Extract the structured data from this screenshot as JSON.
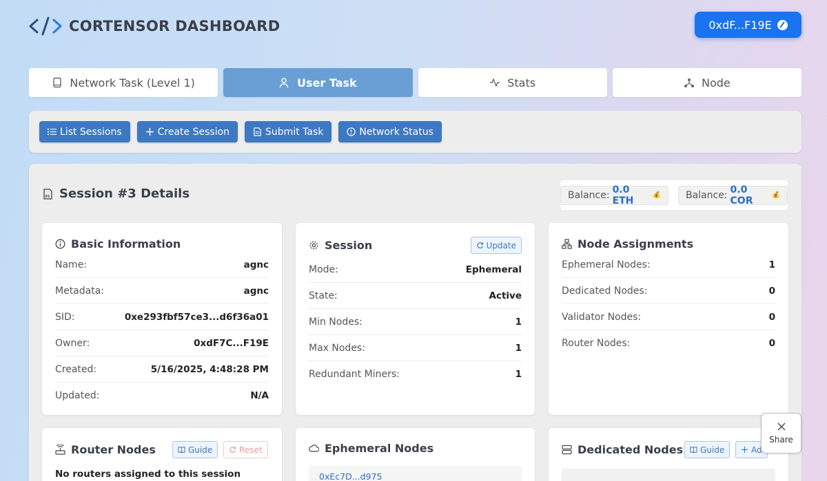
{
  "header": {
    "title": "CORTENSOR DASHBOARD",
    "wallet": "0xdF...F19E"
  },
  "tabs": [
    {
      "label": "Network Task (Level 1)",
      "icon": "book-icon"
    },
    {
      "label": "User Task",
      "icon": "user-icon"
    },
    {
      "label": "Stats",
      "icon": "activity-icon"
    },
    {
      "label": "Node",
      "icon": "network-icon"
    }
  ],
  "toolbar": {
    "list": "List Sessions",
    "create": "Create Session",
    "submit": "Submit Task",
    "status": "Network Status"
  },
  "session": {
    "title": "Session #3 Details",
    "balance_label": "Balance:",
    "balance_eth": "0.0 ETH",
    "balance_cor": "0.0 COR"
  },
  "basic": {
    "title": "Basic Information",
    "rows": [
      {
        "k": "Name:",
        "v": "agnc"
      },
      {
        "k": "Metadata:",
        "v": "agnc"
      },
      {
        "k": "SID:",
        "v": "0xe293fbf57ce3...d6f36a01"
      },
      {
        "k": "Owner:",
        "v": "0xdF7C...F19E"
      },
      {
        "k": "Created:",
        "v": "5/16/2025, 4:48:28 PM"
      },
      {
        "k": "Updated:",
        "v": "N/A"
      }
    ]
  },
  "sessioncard": {
    "title": "Session",
    "update": "Update",
    "rows": [
      {
        "k": "Mode:",
        "v": "Ephemeral"
      },
      {
        "k": "State:",
        "v": "Active"
      },
      {
        "k": "Min Nodes:",
        "v": "1"
      },
      {
        "k": "Max Nodes:",
        "v": "1"
      },
      {
        "k": "Redundant Miners:",
        "v": "1"
      }
    ]
  },
  "assign": {
    "title": "Node Assignments",
    "rows": [
      {
        "k": "Ephemeral Nodes:",
        "v": "1"
      },
      {
        "k": "Dedicated Nodes:",
        "v": "0"
      },
      {
        "k": "Validator Nodes:",
        "v": "0"
      },
      {
        "k": "Router Nodes:",
        "v": "0"
      }
    ]
  },
  "router": {
    "title": "Router Nodes",
    "guide": "Guide",
    "reset": "Reset",
    "empty": "No routers assigned to this session"
  },
  "ephemeral": {
    "title": "Ephemeral Nodes",
    "first": "0xEc7D...d975"
  },
  "dedicated": {
    "title": "Dedicated Nodes",
    "guide": "Guide",
    "add": "Ad"
  },
  "share": {
    "label": "Share"
  }
}
